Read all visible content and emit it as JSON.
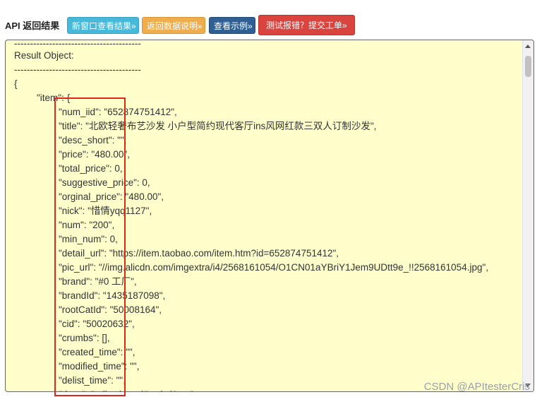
{
  "header": {
    "title": "API 返回结果",
    "buttons": {
      "new_window": "新窗口查看结果»",
      "return_docs": "返回数据说明»",
      "view_example": "查看示例»",
      "report_error": "测试报错？提交工单»"
    }
  },
  "result": {
    "lines": [
      {
        "indent": 0,
        "text": "----------------------------------------"
      },
      {
        "indent": 0,
        "text": "Result Object:"
      },
      {
        "indent": 0,
        "text": "----------------------------------------"
      },
      {
        "indent": 0,
        "text": "{"
      },
      {
        "indent": 1,
        "text": "\"item\": {"
      },
      {
        "indent": 2,
        "text": "\"num_iid\": \"652874751412\","
      },
      {
        "indent": 2,
        "text": "\"title\": \"北欧轻奢布艺沙发 小户型简约现代客厅ins风网红款三双人订制沙发\","
      },
      {
        "indent": 2,
        "text": "\"desc_short\": \"\","
      },
      {
        "indent": 2,
        "text": "\"price\": \"480.00\","
      },
      {
        "indent": 2,
        "text": "\"total_price\": 0,"
      },
      {
        "indent": 2,
        "text": "\"suggestive_price\": 0,"
      },
      {
        "indent": 2,
        "text": "\"orginal_price\": \"480.00\","
      },
      {
        "indent": 2,
        "text": "\"nick\": \"惜情yqq1127\","
      },
      {
        "indent": 2,
        "text": "\"num\": \"200\","
      },
      {
        "indent": 2,
        "text": "\"min_num\": 0,"
      },
      {
        "indent": 2,
        "text": "\"detail_url\": \"https://item.taobao.com/item.htm?id=652874751412\","
      },
      {
        "indent": 2,
        "text": "\"pic_url\": \"//img.alicdn.com/imgextra/i4/2568161054/O1CN01aYBriY1Jem9UDtt9e_!!2568161054.jpg\","
      },
      {
        "indent": 2,
        "text": "\"brand\": \"#0 工厂\","
      },
      {
        "indent": 2,
        "text": "\"brandId\": \"1435187098\","
      },
      {
        "indent": 2,
        "text": "\"rootCatId\": \"50008164\","
      },
      {
        "indent": 2,
        "text": "\"cid\": \"50020632\","
      },
      {
        "indent": 2,
        "text": "\"crumbs\": [],"
      },
      {
        "indent": 2,
        "text": "\"created_time\": \"\","
      },
      {
        "indent": 2,
        "text": "\"modified_time\": \"\","
      },
      {
        "indent": 2,
        "text": "\"delist_time\": \"\","
      },
      {
        "indent": 2,
        "text": "\"desc\": \"<div class=\\\"xxd...\\\">...\","
      }
    ]
  },
  "watermark": "CSDN @APItesterCris"
}
